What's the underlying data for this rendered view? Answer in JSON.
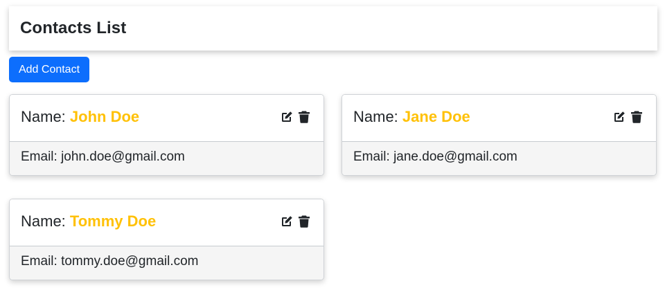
{
  "header": {
    "title": "Contacts List"
  },
  "toolbar": {
    "add_label": "Add Contact"
  },
  "labels": {
    "name_prefix": "Name: ",
    "email_prefix": "Email: "
  },
  "contacts": [
    {
      "name": "John Doe",
      "email": "john.doe@gmail.com"
    },
    {
      "name": "Jane Doe",
      "email": "jane.doe@gmail.com"
    },
    {
      "name": "Tommy Doe",
      "email": "tommy.doe@gmail.com"
    }
  ],
  "icons": {
    "edit": "edit-icon",
    "delete": "trash-icon"
  },
  "colors": {
    "accent": "#0d6efd",
    "name_highlight": "#ffc107",
    "card_body_bg": "#f5f5f5"
  }
}
